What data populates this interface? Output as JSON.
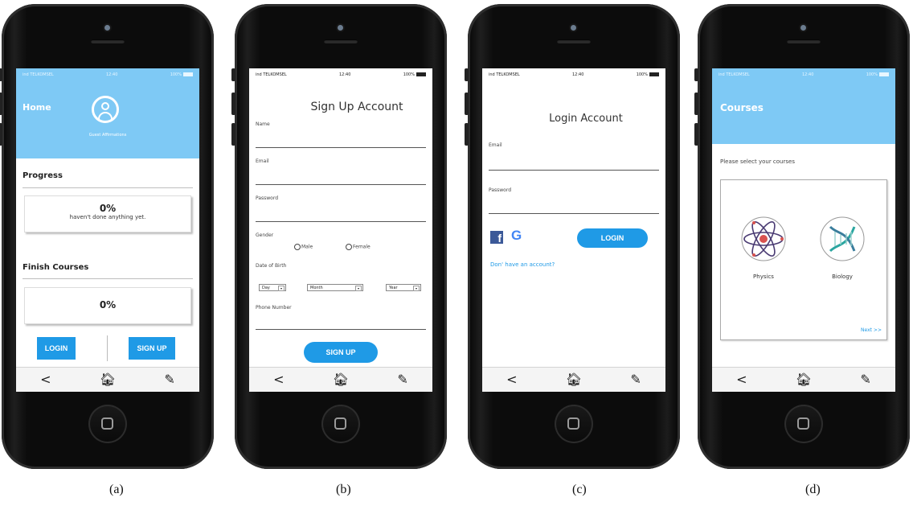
{
  "phones": {
    "a": {
      "status": {
        "carrier": "ind TELKOMSEL",
        "time": "12:40",
        "battery": "100%"
      },
      "header_title": "Home",
      "user_label": "Guest Affirmations",
      "progress": {
        "title": "Progress",
        "value": "0%",
        "message": "haven't done anything yet."
      },
      "finish": {
        "title": "Finish Courses",
        "value": "0%"
      },
      "login_label": "LOGIN",
      "signup_label": "SIGN UP"
    },
    "b": {
      "status": {
        "carrier": "ind TELKOMSEL",
        "time": "12:40",
        "battery": "100%"
      },
      "title": "Sign Up Account",
      "name_label": "Name",
      "email_label": "Email",
      "password_label": "Password",
      "gender_label": "Gender",
      "gender_options": [
        "Male",
        "Female"
      ],
      "dob_label": "Date of Birth",
      "dob_selects": [
        "Day",
        "Month",
        "Year"
      ],
      "phone_label": "Phone Number",
      "signup_label": "SIGN UP"
    },
    "c": {
      "status": {
        "carrier": "ind TELKOMSEL",
        "time": "12:40",
        "battery": "100%"
      },
      "title": "Login Account",
      "email_label": "Email",
      "password_label": "Password",
      "facebook_glyph": "f",
      "google_glyph": "G",
      "login_label": "LOGIN",
      "no_account_link": "Don' have an account?"
    },
    "d": {
      "status": {
        "carrier": "ind TELKOMSEL",
        "time": "12:40",
        "battery": "100%"
      },
      "header_title": "Courses",
      "prompt": "Please select your courses",
      "courses": [
        "Physics",
        "Biology"
      ],
      "next_label": "Next >>"
    }
  },
  "nav": {
    "back_glyph": "<",
    "home_glyph": "🏠︎",
    "edit_glyph": "✎"
  },
  "captions": [
    "(a)",
    "(b)",
    "(c)",
    "(d)"
  ],
  "colors": {
    "header_blue": "#7ec9f5",
    "button_blue": "#1f9ae6",
    "facebook": "#3b5998"
  }
}
